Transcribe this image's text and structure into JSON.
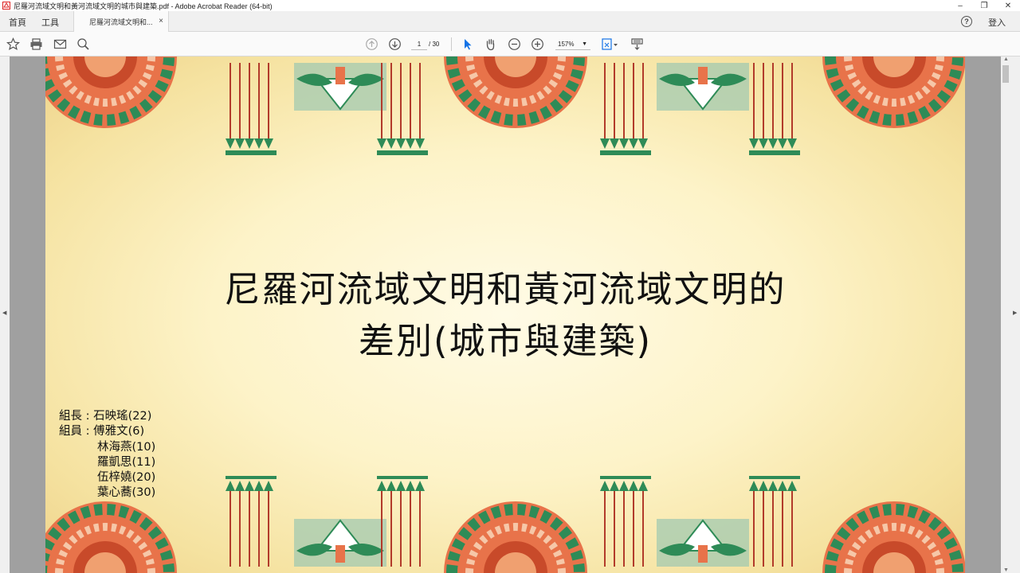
{
  "window": {
    "title": "尼羅河流域文明和黃河流域文明的城市與建築.pdf - Adobe Acrobat Reader (64-bit)"
  },
  "tabs": {
    "home": "首頁",
    "tools": "工具",
    "document": "尼羅河流域文明和...",
    "close": "×"
  },
  "account": {
    "help": "?",
    "login": "登入"
  },
  "toolbar": {
    "current_page": "1",
    "total_pages": "/ 30",
    "zoom": "157%"
  },
  "slide": {
    "title_line1": "尼羅河流域文明和黃河流域文明的",
    "title_line2": "差別(城市與建築)",
    "members": [
      "組長 : 石映瑤(22)",
      "組員 : 傅雅文(6)",
      "林海燕(10)",
      "羅凱思(11)",
      "伍梓嬈(20)",
      "葉心蕎(30)"
    ]
  },
  "colors": {
    "accent_blue": "#1473e6",
    "papyrus": "#fdf3c8",
    "pattern_green": "#2e8b57",
    "pattern_orange": "#e8734a",
    "pattern_red": "#b23b2b"
  }
}
